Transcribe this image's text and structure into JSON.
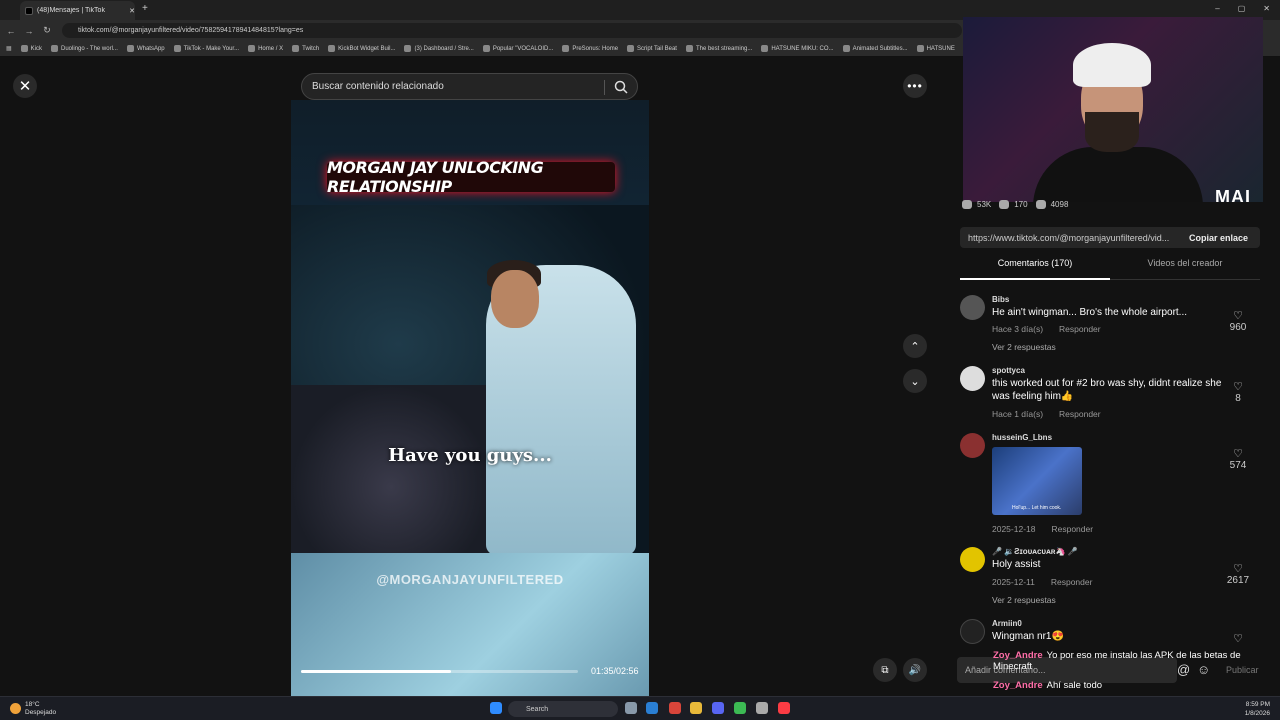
{
  "browser": {
    "tab_title": "(48)Mensajes | TikTok",
    "url": "tiktok.com/@morganjayunfiltered/video/7582594178941484815?lang=es",
    "bookmarks": [
      "Kick",
      "Duolingo - The worl...",
      "WhatsApp",
      "TikTok - Make Your...",
      "Home / X",
      "Twitch",
      "KickBot Widget Buil...",
      "(3) Dashboard / Stre...",
      "Popular \"VOCALOID...",
      "PreSonus: Home",
      "Script Tail Beat",
      "The best streaming...",
      "HATSUNE MIKU: CO...",
      "Animated Subtitles...",
      "HATSUNE"
    ],
    "bookmarks_more": "ores"
  },
  "search": {
    "placeholder": "Buscar contenido relacionado"
  },
  "video": {
    "banner": "MORGAN JAY UNLOCKING RELATIONSHIP",
    "caption": "Have you guys...",
    "watermark": "@MORGANJAYUNFILTERED",
    "time": "01:35/02:56",
    "progress": 0.54
  },
  "stream": {
    "tag": "MAI"
  },
  "stats": {
    "likes": "53K",
    "comments": "170",
    "saves": "4098"
  },
  "share": {
    "link": "https://www.tiktok.com/@morganjayunfiltered/vid...",
    "copy": "Copiar enlace"
  },
  "tabs": {
    "comments": "Comentarios (170)",
    "videos": "Videos del creador"
  },
  "comments": [
    {
      "user": "Bibs",
      "text": "He ain't wingman... Bro's the whole airport...",
      "date": "Hace 3 día(s)",
      "reply": "Responder",
      "replies": "Ver 2 respuestas",
      "likes": "960"
    },
    {
      "user": "spottyca",
      "text": "this worked out for #2 bro was shy, didnt realize she was feeling him👍",
      "date": "Hace 1 día(s)",
      "reply": "Responder",
      "likes": "8"
    },
    {
      "user": "husseinG_Lbns",
      "gif_caption": "Hol'up... Let him cook.",
      "date": "2025-12-18",
      "reply": "Responder",
      "likes": "574"
    },
    {
      "user": "🎤 🔉Ƨɪᴏᴜᴀᴄᴜᴀʀ🦄 🎤",
      "text": "Holy assist",
      "date": "2025-12-11",
      "reply": "Responder",
      "replies": "Ver 2 respuestas",
      "likes": "2617"
    },
    {
      "user": "Armiin0",
      "text": "Wingman nr1😍"
    }
  ],
  "chat": [
    {
      "name": "Zoy_Andre",
      "text": "Yo por eso me instalo las APK de las betas de Minecraft"
    },
    {
      "name": "Zoy_Andre",
      "text": "Ahí sale todo"
    }
  ],
  "composer": {
    "placeholder": "Añadir comentario...",
    "publish": "Publicar"
  },
  "taskbar": {
    "temp": "18°C",
    "weather": "Despejado",
    "search": "Search",
    "time": "8:59 PM",
    "date": "1/8/2026"
  },
  "colors": {
    "accent": "#fe2c55",
    "chat_name": "#ff6ea8"
  }
}
